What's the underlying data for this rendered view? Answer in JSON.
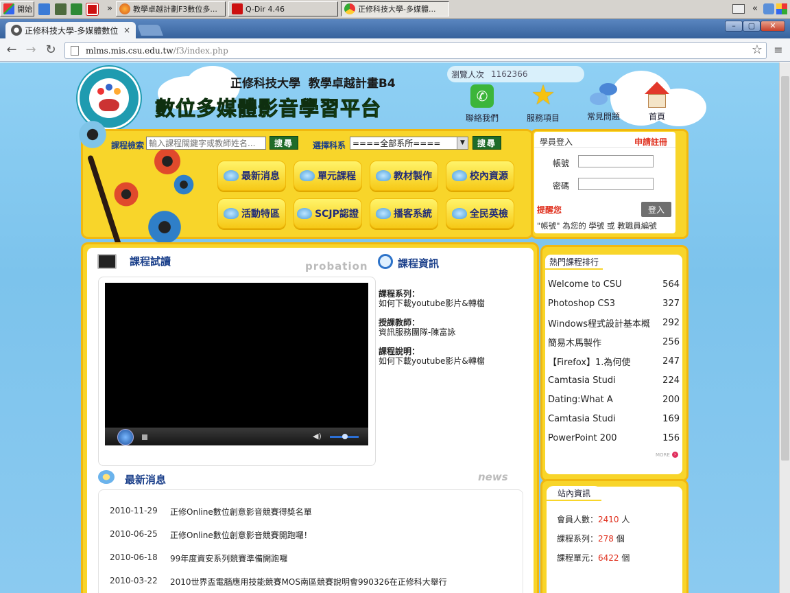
{
  "taskbar": {
    "start_label": "開始",
    "tasks": [
      {
        "label": "教學卓越計劃F3數位多...",
        "active": false
      },
      {
        "label": "Q-Dir 4.46",
        "active": false
      },
      {
        "label": "正修科技大學-多媒體...",
        "active": true
      }
    ],
    "overflow": "»",
    "tray_chevron": "«"
  },
  "browser": {
    "tab_title": "正修科技大學-多媒體數位",
    "tab_close": "×",
    "url_host": "mlms.mis.csu.edu.tw",
    "url_path": "/f3/index.php",
    "win_min": "–",
    "win_max": "▢",
    "win_close": "✕"
  },
  "header": {
    "school": "正修科技大學",
    "program": "教學卓越計畫B4",
    "platform_title": "數位多媒體影音學習平台",
    "visitor_label": "瀏覽人次",
    "visitor_count": "1162366",
    "logo_ring_text": "教學卓越.學習卓越",
    "logo_bottom_text": "Excellent Teaching & Learning",
    "nav": [
      {
        "label": "聯絡我們",
        "icon": "phone-icon"
      },
      {
        "label": "服務項目",
        "icon": "star-icon"
      },
      {
        "label": "常見問題",
        "icon": "question-bubble-icon"
      },
      {
        "label": "首頁",
        "icon": "home-icon"
      }
    ]
  },
  "search": {
    "course_label": "課程檢索",
    "course_placeholder": "輸入課程關鍵字或教師姓名...",
    "search_button": "搜尋",
    "dept_label": "選擇科系",
    "dept_selected": "====全部系所====",
    "dept_button": "搜尋"
  },
  "menu": [
    "最新消息",
    "單元課程",
    "教材製作",
    "校內資源",
    "活動特區",
    "SCJP認證",
    "播客系統",
    "全民英檢"
  ],
  "login": {
    "title": "學員登入",
    "register": "申請註冊",
    "account_label": "帳號",
    "password_label": "密碼",
    "remind": "提醒您",
    "login_button": "登入",
    "hint": "\"帳號\" 為您的 學號 或 教職員編號"
  },
  "trial": {
    "title": "課程試讀",
    "watermark": "probation"
  },
  "course_info": {
    "title": "課程資訊",
    "series_label": "課程系列：",
    "series_value": "如何下載youtube影片&轉檔",
    "teacher_label": "授課教師：",
    "teacher_value": "資訊服務團隊-陳富詠",
    "desc_label": "課程說明：",
    "desc_value": "如何下載youtube影片&轉檔"
  },
  "news": {
    "title": "最新消息",
    "watermark": "news",
    "items": [
      {
        "date": "2010-11-29",
        "text": "正修Online數位創意影音競賽得獎名單"
      },
      {
        "date": "2010-06-25",
        "text": "正修Online數位創意影音競賽開跑囉！"
      },
      {
        "date": "2010-06-18",
        "text": "99年度資安系列競賽準備開跑囉"
      },
      {
        "date": "2010-03-22",
        "text": "2010世界盃電腦應用技能競賽MOS南區競賽說明會990326在正修科大舉行"
      }
    ]
  },
  "ranking": {
    "title": "熱門課程排行",
    "more": "MORE",
    "items": [
      {
        "name": "Welcome to CSU",
        "count": "564"
      },
      {
        "name": "Photoshop CS3",
        "count": "327"
      },
      {
        "name": "Windows程式設計基本概",
        "count": "292"
      },
      {
        "name": "簡易木馬製作",
        "count": "256"
      },
      {
        "name": "【Firefox】1.為何使",
        "count": "247"
      },
      {
        "name": "Camtasia Studi",
        "count": "224"
      },
      {
        "name": "Dating:What A",
        "count": "200"
      },
      {
        "name": "Camtasia Studi",
        "count": "169"
      },
      {
        "name": "PowerPoint 200",
        "count": "156"
      }
    ]
  },
  "site_info": {
    "title": "站內資訊",
    "members_label": "會員人數：",
    "members_value": "2410",
    "members_unit": "人",
    "series_label": "課程系列：",
    "series_value": "278",
    "series_unit": "個",
    "units_label": "課程單元：",
    "units_value": "6422",
    "units_unit": "個"
  },
  "colors": {
    "sky": "#7fc7ee",
    "yellow": "#f8d52a",
    "title_blue": "#1a3f8a",
    "accent_red": "#e0301e",
    "search_green": "#1f6b2a"
  }
}
